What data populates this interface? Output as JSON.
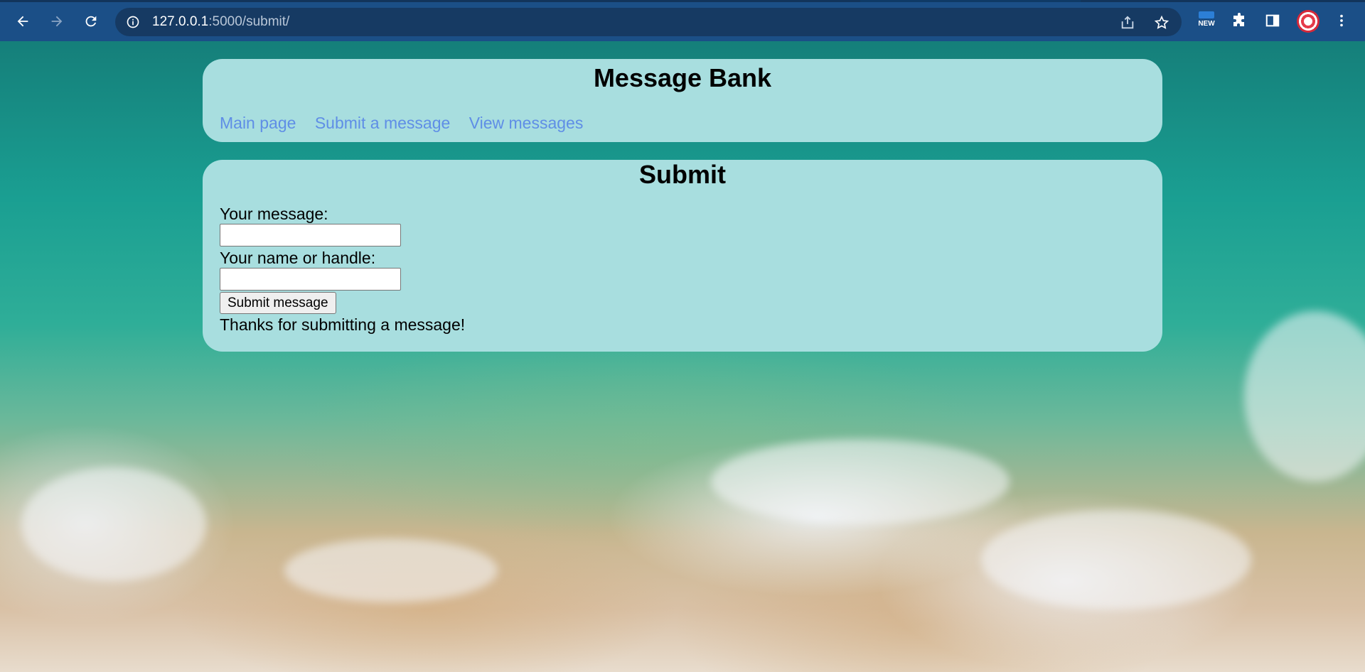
{
  "browser": {
    "url_host": "127.0.0.1",
    "url_path": ":5000/submit/",
    "new_badge": "NEW",
    "icons": [
      "back-icon",
      "forward-icon",
      "reload-icon",
      "info-icon",
      "share-icon",
      "star-icon",
      "extension-new-icon",
      "puzzle-icon",
      "sidepanel-icon",
      "profile-avatar",
      "menu-icon"
    ]
  },
  "header": {
    "title": "Message Bank",
    "nav": [
      "Main page",
      "Submit a message",
      "View messages"
    ]
  },
  "submit": {
    "title": "Submit",
    "message_label": "Your message:",
    "message_value": "",
    "name_label": "Your name or handle:",
    "name_value": "",
    "button_label": "Submit message",
    "thanks": "Thanks for submitting a message!"
  },
  "colors": {
    "card_bg": "#a8dedf",
    "link": "#5f8ee6",
    "chrome": "#1b4f87"
  }
}
